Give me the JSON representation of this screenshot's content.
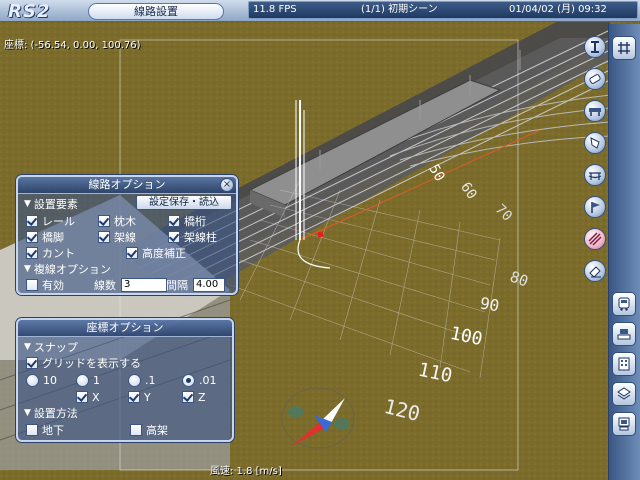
{
  "app": {
    "logo": "RS2",
    "mode": "線路設置"
  },
  "infobar": {
    "fps": "11.8 FPS",
    "scene": "(1/1) 初期シーン",
    "datetime": "01/04/02 (月) 09:32"
  },
  "coord_readout": "座標: (-56.54, 0.00, 100.76)",
  "wind_readout": "風速: 1.8 [m/s]",
  "scene_labels": [
    "50",
    "60",
    "70",
    "80",
    "90",
    "100",
    "110",
    "120"
  ],
  "track_panel": {
    "title": "線路オプション",
    "save_load_button": "設定保存・読込",
    "section_elements": "設置要素",
    "items": [
      {
        "label": "レール",
        "checked": true
      },
      {
        "label": "枕木",
        "checked": true
      },
      {
        "label": "橋桁",
        "checked": true
      },
      {
        "label": "橋脚",
        "checked": true
      },
      {
        "label": "架線",
        "checked": true
      },
      {
        "label": "架線柱",
        "checked": true
      },
      {
        "label": "カント",
        "checked": true
      },
      {
        "label": "高度補正",
        "checked": true
      }
    ],
    "section_multi": "複線オプション",
    "enabled_label": "有効",
    "track_count_label": "線数",
    "track_count_value": "3",
    "spacing_label": "間隔",
    "spacing_value": "4.00"
  },
  "coord_panel": {
    "title": "座標オプション",
    "section_snap": "スナップ",
    "show_grid_label": "グリッドを表示する",
    "show_grid_checked": true,
    "snap_options": [
      "10",
      "1",
      ".1",
      ".01"
    ],
    "snap_selected": ".01",
    "axes": [
      {
        "label": "X",
        "checked": true
      },
      {
        "label": "Y",
        "checked": true
      },
      {
        "label": "Z",
        "checked": true
      }
    ],
    "section_method": "設置方法",
    "underground_label": "地下",
    "elevated_label": "高架"
  },
  "colors": {
    "ground": "#7a6a2a",
    "panel": "#3a5486",
    "accent": "#c46a8c"
  },
  "right_toolbar_icons": [
    "rail-tool-icon",
    "tie-tool-icon",
    "bridge-tool-icon",
    "pier-tool-icon",
    "catenary-tool-icon",
    "signal-tool-icon",
    "crossing-tool-icon",
    "eraser-tool-icon"
  ],
  "right_toolbar_lower_icons": [
    "train-icon",
    "station-icon",
    "building-icon",
    "layer-icon",
    "computer-icon"
  ],
  "toolbar_top_grid_icon": "grid-icon"
}
